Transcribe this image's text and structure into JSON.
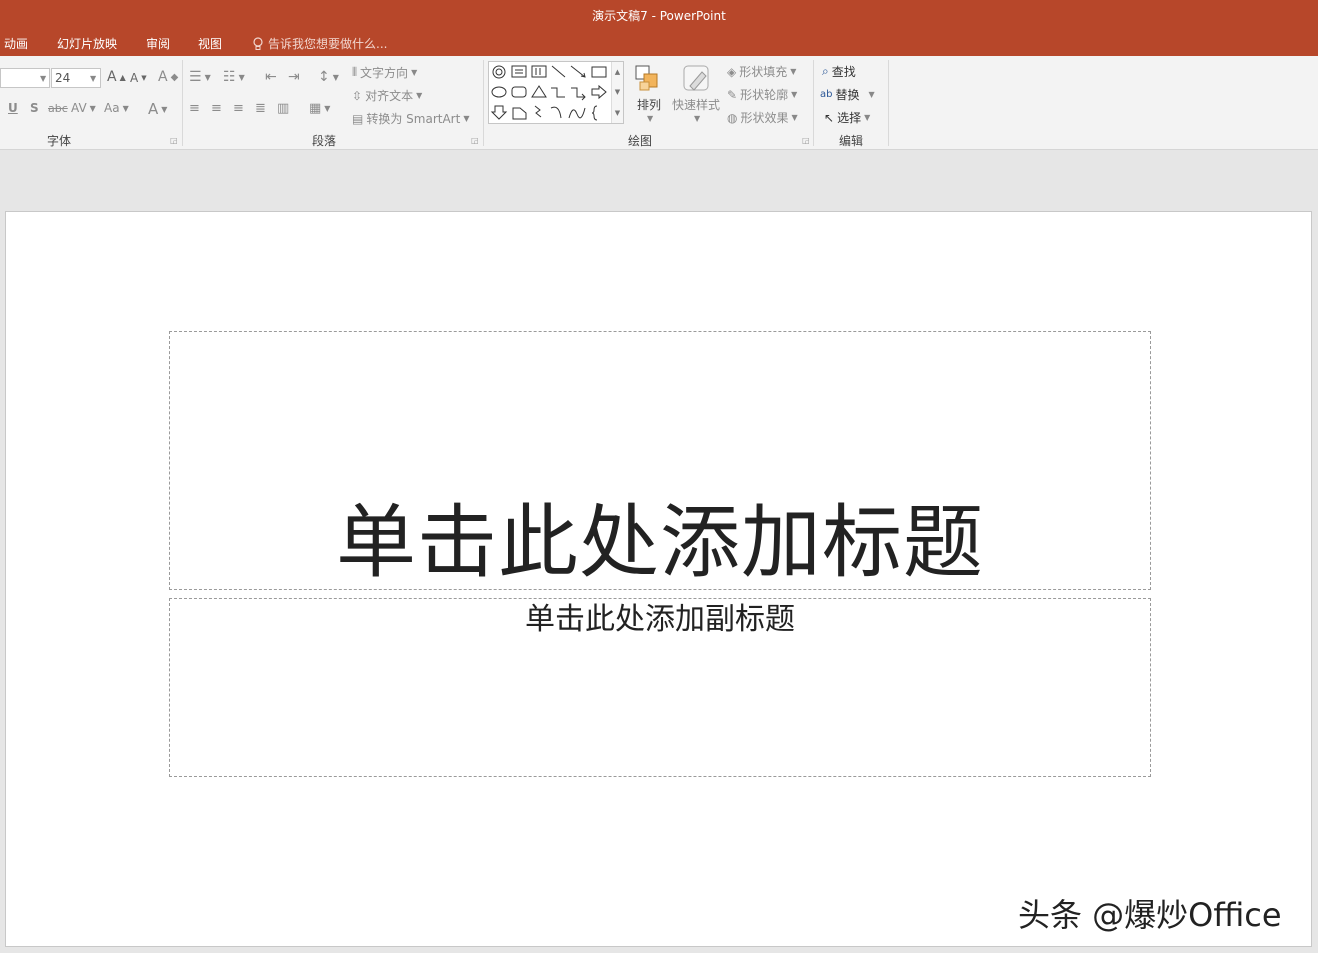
{
  "window": {
    "title": "演示文稿7 - PowerPoint"
  },
  "menu": {
    "items": [
      "动画",
      "幻灯片放映",
      "审阅",
      "视图"
    ],
    "tell_me": "告诉我您想要做什么..."
  },
  "ribbon": {
    "font": {
      "label": "字体",
      "font_name": "",
      "font_size": "24",
      "grow": "A",
      "shrink": "A",
      "clear": "A",
      "underline": "U",
      "shadow": "S",
      "strike": "abc",
      "spacing": "AV",
      "case": "Aa",
      "color": "A"
    },
    "paragraph": {
      "label": "段落",
      "text_direction": "文字方向",
      "align_text": "对齐文本",
      "convert_smartart": "转换为 SmartArt"
    },
    "drawing": {
      "label": "绘图",
      "arrange": "排列",
      "quick_styles": "快速样式",
      "shape_fill": "形状填充",
      "shape_outline": "形状轮廓",
      "shape_effects": "形状效果"
    },
    "editing": {
      "label": "编辑",
      "find": "查找",
      "replace": "替换",
      "select": "选择"
    }
  },
  "slide": {
    "title_placeholder": "单击此处添加标题",
    "subtitle_placeholder": "单击此处添加副标题"
  },
  "watermark": "头条 @爆炒Office"
}
